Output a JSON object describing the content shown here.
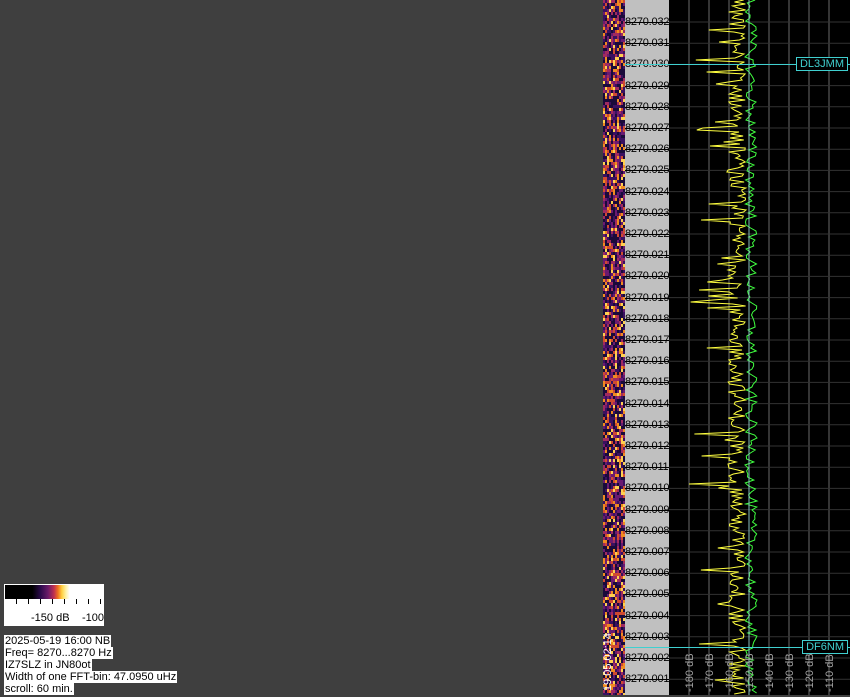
{
  "frequency_labels": [
    "8270.032",
    "8270.031",
    "8270.030",
    "8270.029",
    "8270.028",
    "8270.027",
    "8270.026",
    "8270.025",
    "8270.024",
    "8270.023",
    "8270.022",
    "8270.021",
    "8270.020",
    "8270.019",
    "8270.018",
    "8270.017",
    "8270.016",
    "8270.015",
    "8270.014",
    "8270.013",
    "8270.012",
    "8270.011",
    "8270.010",
    "8270.009",
    "8270.008",
    "8270.007",
    "8270.006",
    "8270.005",
    "8270.004",
    "8270.003",
    "8270.002",
    "8270.001"
  ],
  "db_labels": [
    "-180 dB",
    "-170 dB",
    "-160 dB",
    "-150 dB",
    "-140 dB",
    "-130 dB",
    "-120 dB",
    "-110 dB"
  ],
  "markers": [
    {
      "callsign": "DL3JMM",
      "freq": "8270.030"
    },
    {
      "callsign": "DF6NM",
      "freq": "8270.0025"
    }
  ],
  "legend": {
    "low_label": "-150 dB",
    "high_label": "-100"
  },
  "waterfall_time": "19.05 02:14",
  "info": {
    "datetime": "2025-05-19 16:00 NB",
    "freq_range": "Freq= 8270...8270 Hz",
    "station": "IZ7SLZ in JN80ot",
    "fft_bin": "Width of one FFT-bin: 47.0950 uHz",
    "scroll": "scroll: 60 min."
  },
  "colors": {
    "background": "#3f3f3f",
    "marker": "#40d0d0",
    "yellow_trace": "#ffff40",
    "green_trace": "#40ff40"
  }
}
